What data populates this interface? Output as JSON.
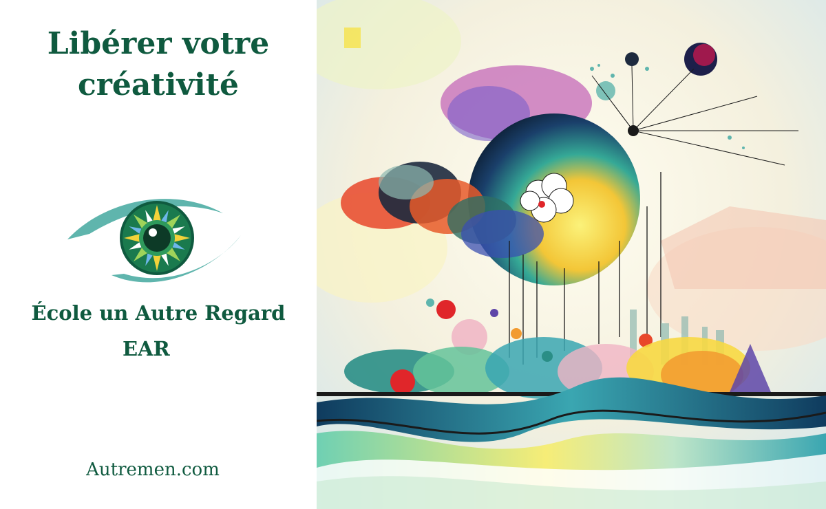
{
  "headline": {
    "line1": "Libérer votre",
    "line2": "créativité"
  },
  "logo": {
    "icon": "eye-icon",
    "colors": {
      "eye_outline": "#5fb5ad",
      "iris": "#1a7a4e",
      "pupil": "#0d3a27",
      "star_accents": [
        "#f2d23a",
        "#9fd35a",
        "#6db7ea"
      ]
    }
  },
  "school": {
    "name": "École un Autre Regard",
    "abbreviation": "EAR"
  },
  "website": "Autremen.com",
  "artwork": {
    "subject": "watercolor-abstract-landscape",
    "colors": [
      "#0f3b5e",
      "#f7e54a",
      "#e8472a",
      "#2ea58a",
      "#c9468f",
      "#5e45a8"
    ]
  },
  "colors": {
    "text": "#0f5a3f",
    "background": "#ffffff"
  }
}
